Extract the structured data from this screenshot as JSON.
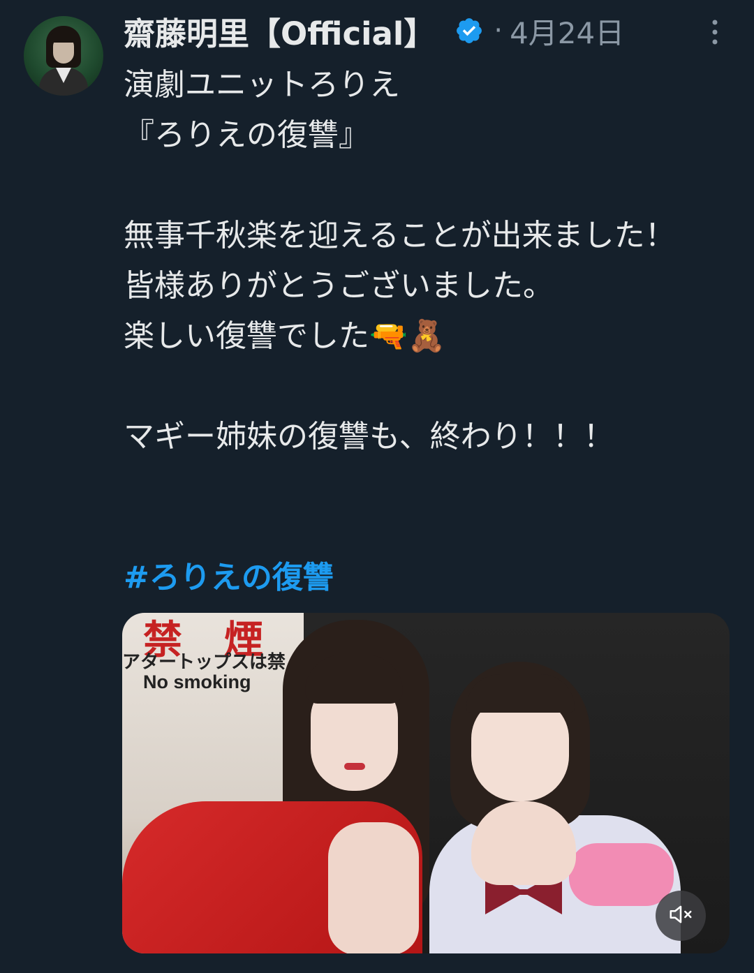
{
  "tweet": {
    "author": {
      "display_name": "齋藤明里【Official】",
      "verified": true
    },
    "separator": "·",
    "timestamp": "4月24日",
    "body": "演劇ユニットろりえ\n『ろりえの復讐』\n\n無事千秋楽を迎えることが出来ました！\n皆様ありがとうございました。\n楽しい復讐でした🔫🧸\n\nマギー姉妹の復讐も、終わり！！！",
    "hashtag": "#ろりえの復讐",
    "media": {
      "type": "video",
      "sign_text_line1": "アタートップスは禁",
      "sign_text_line2": "No smoking",
      "sign_kanji": "禁煙",
      "audio_state": "muted"
    }
  },
  "colors": {
    "background": "#15202b",
    "text": "#e7e9ea",
    "secondary_text": "#8b98a5",
    "link": "#1d9bf0",
    "verified_badge": "#1d9bf0"
  },
  "icons": {
    "verified": "verified-badge-icon",
    "more": "more-options-icon",
    "mute": "speaker-muted-icon"
  }
}
